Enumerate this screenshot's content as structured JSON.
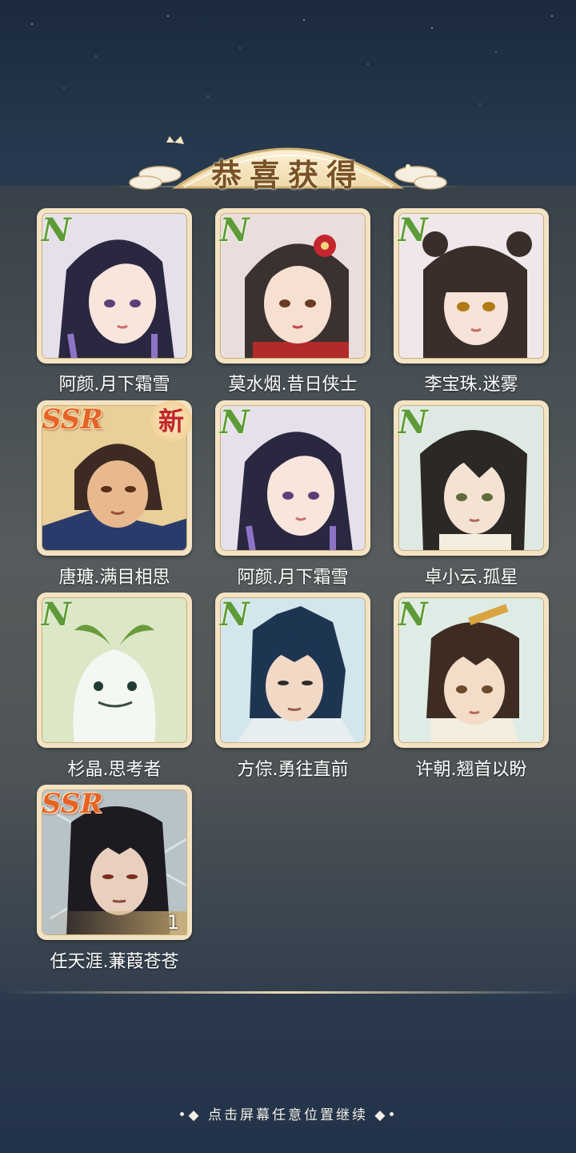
{
  "title": "恭喜获得",
  "continue_hint": "点击屏幕任意位置继续",
  "continue_deco_left": "•◆",
  "continue_deco_right": "◆•",
  "cards": [
    {
      "name": "阿颜.月下霜雪",
      "rarity": "N",
      "is_new": false,
      "count": null,
      "bg": "#e8e2ea"
    },
    {
      "name": "莫水烟.昔日侠士",
      "rarity": "N",
      "is_new": false,
      "count": null,
      "bg": "#e9dedb"
    },
    {
      "name": "李宝珠.迷雾",
      "rarity": "N",
      "is_new": false,
      "count": null,
      "bg": "#eee6e8"
    },
    {
      "name": "唐瑭.满目相思",
      "rarity": "SSR",
      "is_new": true,
      "new_label": "新",
      "count": null,
      "bg": "#e6c88f"
    },
    {
      "name": "阿颜.月下霜雪",
      "rarity": "N",
      "is_new": false,
      "count": null,
      "bg": "#e8e2ea"
    },
    {
      "name": "卓小云.孤星",
      "rarity": "N",
      "is_new": false,
      "count": null,
      "bg": "#dfe9e4"
    },
    {
      "name": "杉晶.思考者",
      "rarity": "N",
      "is_new": false,
      "count": null,
      "bg": "#dbe7c6"
    },
    {
      "name": "方倧.勇往直前",
      "rarity": "N",
      "is_new": false,
      "count": null,
      "bg": "#d3e6ec"
    },
    {
      "name": "许朝.翘首以盼",
      "rarity": "N",
      "is_new": false,
      "count": null,
      "bg": "#dfece6"
    },
    {
      "name": "任天涯.蒹葭苍苍",
      "rarity": "SSR",
      "is_new": false,
      "count": "1",
      "bg": "#b7c3c9"
    }
  ]
}
